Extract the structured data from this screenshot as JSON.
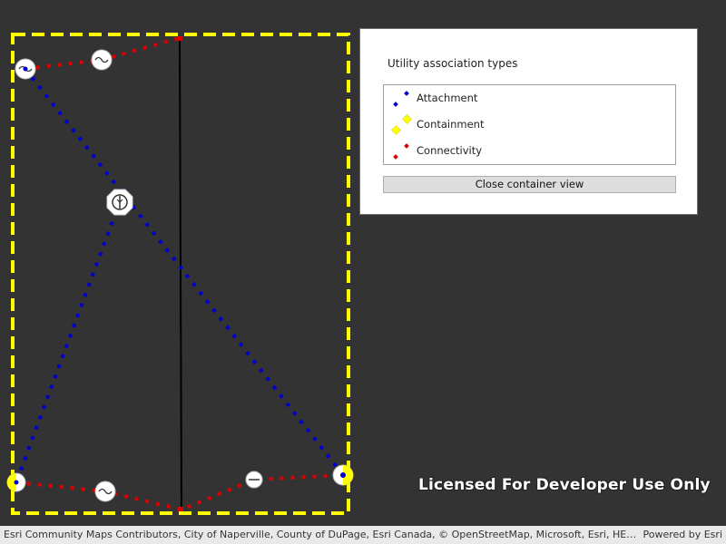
{
  "legend": {
    "title": "Utility association types",
    "items": [
      {
        "label": "Attachment",
        "color": "#0000cc"
      },
      {
        "label": "Containment",
        "color": "#ffff00"
      },
      {
        "label": "Connectivity",
        "color": "#dd0000"
      }
    ],
    "close_button": "Close container view"
  },
  "watermark": "Licensed For Developer Use Only",
  "attribution": {
    "text": "Esri Community Maps Contributors, City of Naperville, County of DuPage, Esri Canada, © OpenStreetMap, Microsoft, Esri, HERE, Garmin",
    "powered_by": "Powered by Esri"
  },
  "colors": {
    "map_background": "#333333",
    "container_outline": "#ffff00",
    "attachment": "#0000cc",
    "connectivity": "#dd0000",
    "line": "#000000"
  }
}
